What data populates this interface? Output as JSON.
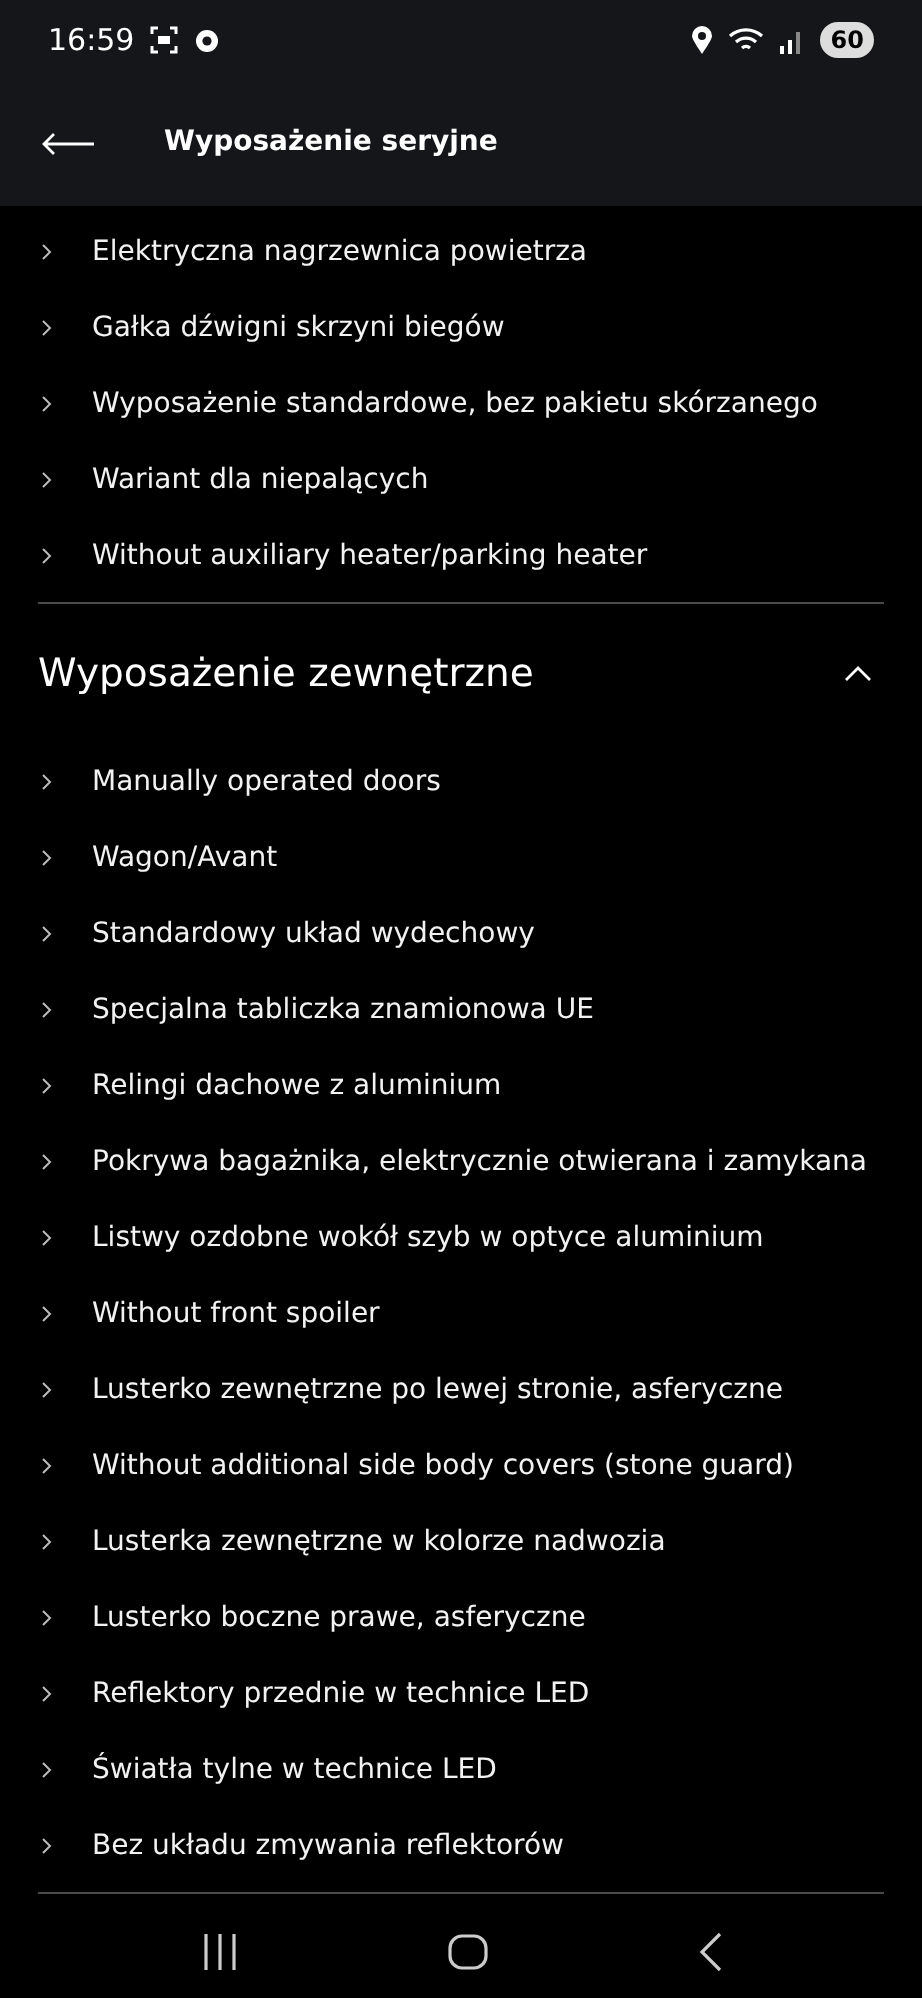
{
  "status_bar": {
    "time": "16:59",
    "battery": "60"
  },
  "header": {
    "title": "Wyposażenie seryjne"
  },
  "sections": [
    {
      "items": [
        "Elektryczna nagrzewnica powietrza",
        "Gałka dźwigni skrzyni biegów",
        "Wyposażenie standardowe, bez pakietu skórzanego",
        "Wariant dla niepalących",
        "Without auxiliary heater/parking heater"
      ]
    },
    {
      "title": "Wyposażenie zewnętrzne",
      "expanded": true,
      "items": [
        "Manually operated doors",
        "Wagon/Avant",
        "Standardowy układ wydechowy",
        "Specjalna tabliczka znamionowa UE",
        "Relingi dachowe z aluminium",
        "Pokrywa bagażnika, elektrycznie otwierana i zamykana",
        "Listwy ozdobne wokół szyb w optyce aluminium",
        "Without front spoiler",
        "Lusterko zewnętrzne po lewej stronie, asferyczne",
        "Without additional side body covers (stone guard)",
        "Lusterka zewnętrzne w kolorze nadwozia",
        "Lusterko boczne prawe, asferyczne",
        "Reflektory przednie w technice LED",
        "Światła tylne w technice LED",
        "Bez układu zmywania reflektorów"
      ]
    }
  ]
}
